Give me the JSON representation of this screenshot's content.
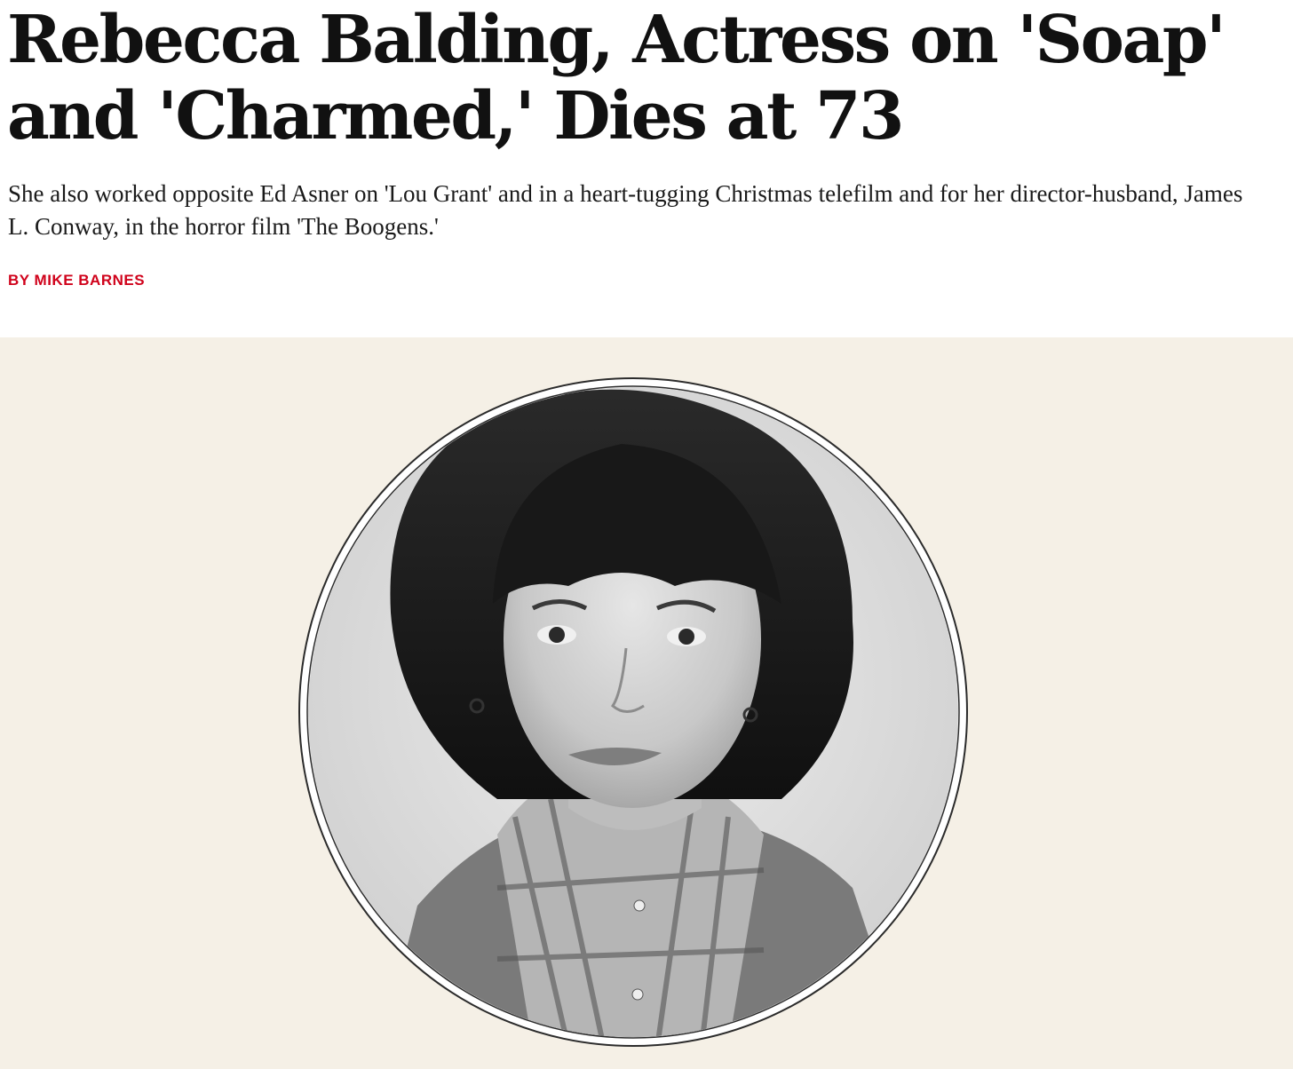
{
  "article": {
    "headline": "Rebecca Balding, Actress on 'Soap' and 'Charmed,' Dies at 73",
    "dek": "She also worked opposite Ed Asner on 'Lou Grant' and in a heart-tugging Christmas telefilm and for her director-husband, James L. Conway, in the horror film 'The Boogens.'",
    "byline_prefix": "BY",
    "author": "MIKE BARNES"
  },
  "colors": {
    "byline_accent": "#d0021b",
    "hero_background": "#f5f0e6",
    "headline_text": "#111111"
  },
  "hero_image": {
    "style": "black-and-white circular portrait",
    "icon": "portrait-photo-icon"
  }
}
